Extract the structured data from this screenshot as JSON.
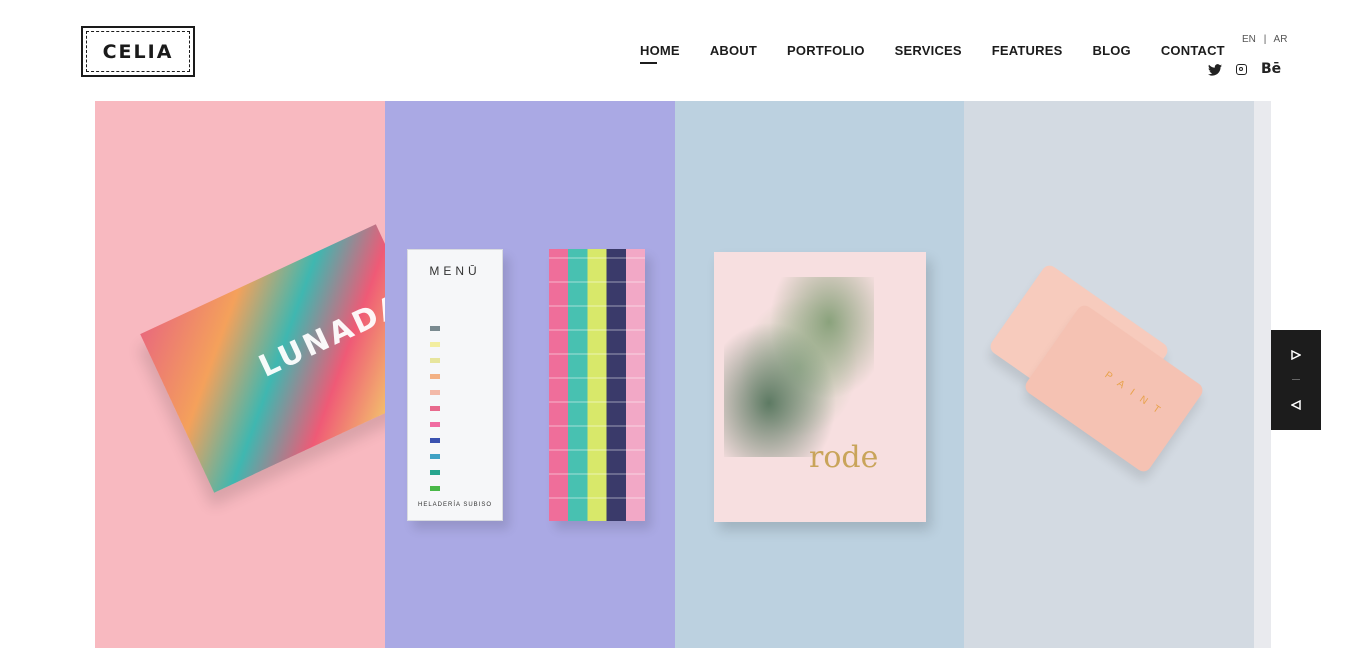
{
  "brand": {
    "logo_text": "CELIA"
  },
  "nav": {
    "items": [
      {
        "label": "HOME",
        "active": true
      },
      {
        "label": "ABOUT"
      },
      {
        "label": "PORTFOLIO"
      },
      {
        "label": "SERVICES"
      },
      {
        "label": "FEATURES"
      },
      {
        "label": "BLOG"
      },
      {
        "label": "CONTACT"
      }
    ]
  },
  "lang": {
    "en": "EN",
    "separator": "|",
    "ar": "AR"
  },
  "social": {
    "behance": "Bē",
    "icons": [
      "twitter-icon",
      "instagram-icon",
      "behance-icon"
    ]
  },
  "slides": {
    "lunada": "LUNADA",
    "menu_title": "MENŪ",
    "menu_footer": "HELADERÍA SUBISO",
    "magazine_word": "rode",
    "gift_word": "PAINT"
  },
  "colors": {
    "panel1": "#f8b9c0",
    "panel2": "#aaa9e4",
    "panel3": "#bcd1e0",
    "panel4": "#d3dae2",
    "arrows_bg": "#1c1c1c"
  }
}
